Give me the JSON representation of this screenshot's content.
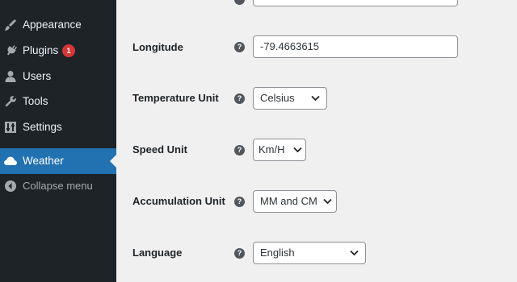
{
  "sidebar": {
    "items": [
      {
        "label": "Appearance",
        "icon": "paintbrush-icon"
      },
      {
        "label": "Plugins",
        "icon": "plugin-icon",
        "badge": "1"
      },
      {
        "label": "Users",
        "icon": "user-icon"
      },
      {
        "label": "Tools",
        "icon": "wrench-icon"
      },
      {
        "label": "Settings",
        "icon": "settings-icon"
      },
      {
        "label": "Weather",
        "icon": "cloud-icon",
        "current": true
      },
      {
        "label": "Collapse menu",
        "icon": "collapse-icon"
      }
    ]
  },
  "form": {
    "longitude": {
      "label": "Longitude",
      "value": "-79.4663615"
    },
    "temperature_unit": {
      "label": "Temperature Unit",
      "value": "Celsius"
    },
    "speed_unit": {
      "label": "Speed Unit",
      "value": "Km/H"
    },
    "accumulation_unit": {
      "label": "Accumulation Unit",
      "value": "MM and CM"
    },
    "language": {
      "label": "Language",
      "value": "English"
    },
    "help_glyph": "?"
  },
  "colors": {
    "sidebar_bg": "#1d2327",
    "current_bg": "#2271b1",
    "badge_bg": "#d63638",
    "content_bg": "#f0f0f1"
  }
}
